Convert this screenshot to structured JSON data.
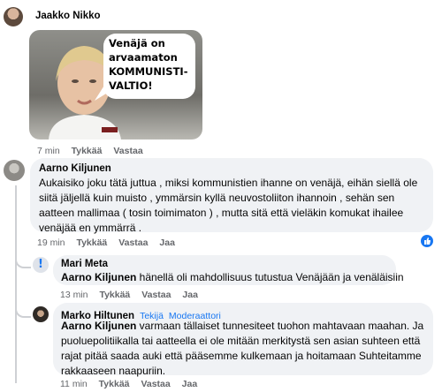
{
  "post": {
    "author": "Jaakko Nikko",
    "meme_text": "Venäjä on arvaamaton KOMMUNISTI-VALTIO!",
    "meta": {
      "time": "7 min",
      "like": "Tykkää",
      "reply": "Vastaa"
    }
  },
  "comment1": {
    "author": "Aarno Kiljunen",
    "text": "Aukaisiko joku tätä juttua , miksi kommunistien ihanne on venäjä, eihän siellä ole siitä jäljellä kuin muisto , ymmärsin kyllä neuvostoliiton ihannoin , sehän sen aatteen mallimaa ( tosin toimimaton ) , mutta sitä että vieläkin komukat ihailee venäjää en ymmärrä .",
    "meta": {
      "time": "19 min",
      "like": "Tykkää",
      "reply": "Vastaa",
      "share": "Jaa"
    }
  },
  "reply1": {
    "author": "Mari Meta",
    "mention": "Aarno Kiljunen",
    "text": " hänellä oli mahdollisuus tutustua Venäjään ja venäläisiin",
    "meta": {
      "time": "13 min",
      "like": "Tykkää",
      "reply": "Vastaa",
      "share": "Jaa"
    }
  },
  "reply2": {
    "author": "Marko Hiltunen",
    "badge1": "Tekijä",
    "badge2": "Moderaattori",
    "mention": "Aarno Kiljunen",
    "text": " varmaan tällaiset tunnesiteet tuohon mahtavaan maahan. Ja puoluepolitiikalla tai aatteella ei ole mitään merkitystä sen asian suhteen että rajat pitää saada auki että pääsemme kulkemaan ja hoitamaan Suhteitamme rakkaaseen naapuriin.",
    "meta": {
      "time": "11 min",
      "like": "Tykkää",
      "reply": "Vastaa",
      "share": "Jaa"
    }
  },
  "colors": {
    "bubble": "#f0f2f5",
    "meta": "#65676b",
    "badge": "#1877f2",
    "like": "#1877f2"
  },
  "icons": {
    "like": "thumbs-up-icon",
    "alert": "alert-icon"
  }
}
